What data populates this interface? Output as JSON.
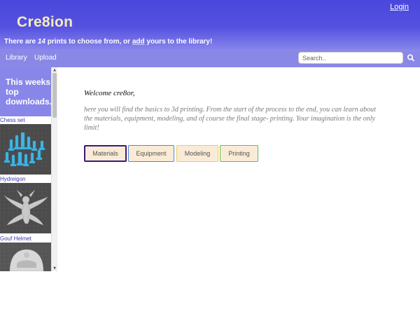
{
  "header": {
    "brand": "Cre8ion",
    "login": "Login",
    "tagline": {
      "pre": "There are ",
      "count": "14",
      "mid": " prints to choose from, or ",
      "add": "add",
      "post": " yours to the library!"
    }
  },
  "nav": {
    "items": [
      "Library",
      "Upload"
    ],
    "search_placeholder": "Search.."
  },
  "sidebar": {
    "heading": "This weeks top downloads.",
    "items": [
      {
        "label": "Chess set",
        "icon": "chess-set-thumbnail"
      },
      {
        "label": "Hydreigon",
        "icon": "hydreigon-thumbnail"
      },
      {
        "label": "Gouf Helmet",
        "icon": "gouf-helmet-thumbnail"
      }
    ]
  },
  "main": {
    "welcome": "Welcome cre8or,",
    "intro": "here you will find the basics to 3d printing. From the start of the process to the end, you can learn about the materials, equipment, modeling, and of course the final stage- printing. Your imagination is the only limit!",
    "buttons": [
      "Materials",
      "Equipment",
      "Modeling",
      "Printing"
    ]
  },
  "colors": {
    "header_top": "#4a47dd",
    "nav_bg": "#8a88e6",
    "brand": "#f6ecb7",
    "button_bg": "#faebd7",
    "materials_border": "#3a1a7a",
    "equipment_border": "#4a8ad8",
    "modeling_border": "#e8cf5a",
    "printing_border": "#5bc05b"
  }
}
